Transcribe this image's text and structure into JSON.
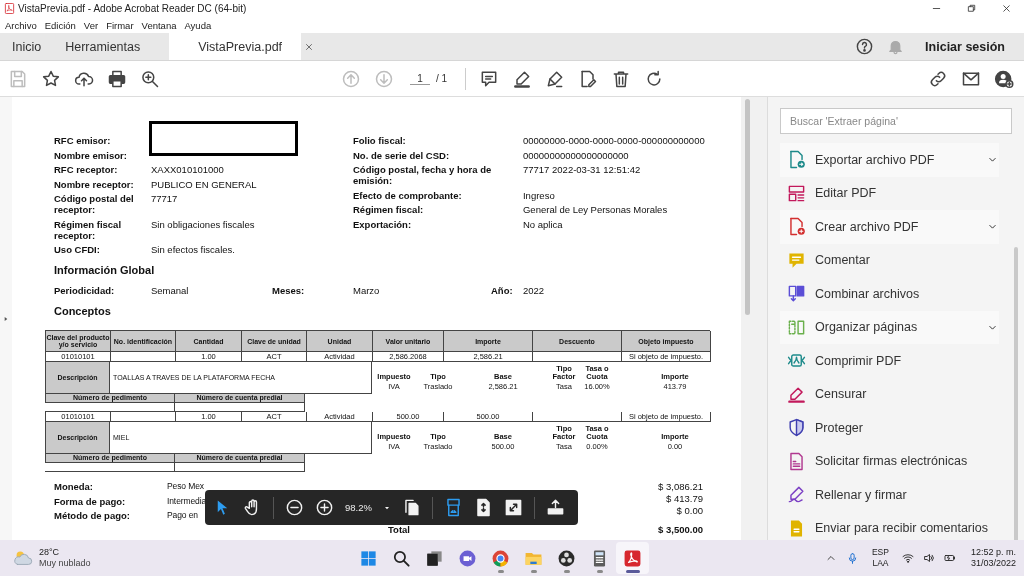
{
  "window": {
    "title": "VistaPrevia.pdf - Adobe Acrobat Reader DC (64-bit)"
  },
  "menu": [
    "Archivo",
    "Edición",
    "Ver",
    "Firmar",
    "Ventana",
    "Ayuda"
  ],
  "tabs": [
    {
      "label": "Inicio",
      "selected": false,
      "kind": "nav"
    },
    {
      "label": "Herramientas",
      "selected": false,
      "kind": "nav"
    },
    {
      "label": "VistaPrevia.pdf",
      "selected": true,
      "kind": "document"
    }
  ],
  "account": {
    "label": "Iniciar sesión"
  },
  "toolbar": {
    "left": [
      {
        "kind": "save",
        "disabled": true
      },
      {
        "kind": "bookmark",
        "disabled": false
      },
      {
        "kind": "upload",
        "disabled": false
      },
      {
        "kind": "print",
        "disabled": false
      },
      {
        "kind": "zoom",
        "disabled": false
      }
    ],
    "nav": [
      {
        "kind": "prev",
        "disabled": true
      },
      {
        "kind": "next",
        "disabled": true
      }
    ],
    "page": "1",
    "page_total": "/ 1",
    "tools": [
      {
        "kind": "comment",
        "disabled": false
      },
      {
        "kind": "highlight",
        "disabled": false
      },
      {
        "kind": "sign",
        "disabled": false
      },
      {
        "kind": "edit",
        "disabled": false
      },
      {
        "kind": "delete",
        "disabled": false
      },
      {
        "kind": "rotate",
        "disabled": false
      }
    ],
    "right": [
      {
        "kind": "link",
        "disabled": false
      },
      {
        "kind": "mail",
        "disabled": false
      },
      {
        "kind": "user",
        "disabled": false
      }
    ]
  },
  "document": {
    "header": {
      "redacted": true,
      "left": [
        {
          "label": "RFC emisor:"
        },
        {
          "label": "Nombre emisor:"
        },
        {
          "label": "RFC receptor:",
          "value": "XAXX010101000"
        },
        {
          "label": "Nombre receptor:",
          "value": "PUBLICO EN GENERAL"
        },
        {
          "label": "Código postal del receptor:",
          "value": "77717"
        },
        {
          "label": "Régimen fiscal receptor:",
          "value": "Sin obligaciones fiscales"
        },
        {
          "label": "Uso CFDI:",
          "value": "Sin efectos fiscales."
        }
      ],
      "right": [
        {
          "label": "Folio fiscal:",
          "value": "00000000-0000-0000-0000-000000000000"
        },
        {
          "label": "No. de serie del CSD:",
          "value": "00000000000000000000"
        },
        {
          "label": "Código postal, fecha y hora de emisión:",
          "value": "77717 2022-03-31 12:51:42"
        },
        {
          "label": "Efecto de comprobante:",
          "value": "Ingreso"
        },
        {
          "label": "Régimen fiscal:",
          "value": "General de Ley Personas Morales"
        },
        {
          "label": "Exportación:",
          "value": "No aplica"
        }
      ]
    },
    "global": {
      "title": "Información Global",
      "fields": [
        {
          "label": "Periodicidad:",
          "value": "Semanal"
        },
        {
          "label": "Meses:",
          "value": "Marzo"
        },
        {
          "label": "Año:",
          "value": "2022"
        }
      ]
    },
    "concepts_title": "Conceptos",
    "table": {
      "columns": [
        "Clave del producto y/o servicio",
        "No. identificación",
        "Cantidad",
        "Clave de unidad",
        "Unidad",
        "Valor unitario",
        "Importe",
        "Descuento",
        "Objeto impuesto"
      ],
      "rows": [
        {
          "clave_producto": "01010101",
          "cantidad": "1.00",
          "clave_unidad": "ACT",
          "unidad": "Actividad",
          "valor_unitario": "2,586.2068",
          "importe": "2,586.21",
          "objeto_impuesto": "Si objeto de impuesto.",
          "description_label": "Descripción",
          "descripcion": "TOALLAS A TRAVES DE LA PLATAFORMA FECHA",
          "tax_columns": [
            "Impuesto",
            "Tipo",
            "Base",
            "Tipo Factor",
            "Tasa o Cuota",
            "Importe"
          ],
          "taxes": [
            {
              "impuesto": "IVA",
              "tipo": "Traslado",
              "base": "2,586.21",
              "tipo_factor": "Tasa",
              "tasa_cuota": "16.00%",
              "importe": "413.79"
            }
          ],
          "pedimento_columns": [
            "Número de pedimento",
            "Número de cuenta predial"
          ]
        },
        {
          "clave_producto": "01010101",
          "cantidad": "1.00",
          "clave_unidad": "ACT",
          "unidad": "Actividad",
          "valor_unitario": "500.00",
          "importe": "500.00",
          "objeto_impuesto": "Si objeto de impuesto.",
          "description_label": "Descripción",
          "descripcion": "MIEL",
          "tax_columns": [
            "Impuesto",
            "Tipo",
            "Base",
            "Tipo Factor",
            "Tasa o Cuota",
            "Importe"
          ],
          "taxes": [
            {
              "impuesto": "IVA",
              "tipo": "Traslado",
              "base": "500.00",
              "tipo_factor": "Tasa",
              "tasa_cuota": "0.00%",
              "importe": "0.00"
            }
          ],
          "pedimento_columns": [
            "Número de pedimento",
            "Número de cuenta predial"
          ]
        }
      ]
    },
    "payment": [
      {
        "label": "Moneda:",
        "value": "Peso Mex"
      },
      {
        "label": "Forma de pago:",
        "value": "Intermedia"
      },
      {
        "label": "Método de pago:",
        "value": "Pago en"
      }
    ],
    "totals": [
      {
        "value": "$ 3,086.21"
      },
      {
        "value": "$ 413.79"
      },
      {
        "value": "$ 0.00"
      },
      {
        "label": "Total",
        "value": "$ 3,500.00"
      }
    ]
  },
  "zoom_bar": {
    "items": [
      {
        "kind": "select",
        "selected": true
      },
      {
        "kind": "hand",
        "selected": false
      },
      {
        "kind": "separator"
      },
      {
        "kind": "zoom_out"
      },
      {
        "kind": "zoom_in"
      },
      {
        "kind": "zoom_value",
        "label": "98.2%"
      },
      {
        "kind": "zoom_menu"
      },
      {
        "kind": "page_display"
      },
      {
        "kind": "separator"
      },
      {
        "kind": "fit_width",
        "selected": true
      },
      {
        "kind": "fit_page",
        "selected": false
      },
      {
        "kind": "full_screen"
      },
      {
        "kind": "separator"
      },
      {
        "kind": "share"
      }
    ]
  },
  "tools_panel": {
    "search": {
      "placeholder": "Buscar 'Extraer página'"
    },
    "items": [
      {
        "label": "Exportar archivo PDF",
        "kind": "export",
        "expandable": true
      },
      {
        "label": "Editar PDF",
        "kind": "edit",
        "expandable": false
      },
      {
        "label": "Crear archivo PDF",
        "kind": "create",
        "expandable": true
      },
      {
        "label": "Comentar",
        "kind": "comment",
        "expandable": false
      },
      {
        "label": "Combinar archivos",
        "kind": "combine",
        "expandable": false
      },
      {
        "label": "Organizar páginas",
        "kind": "organize",
        "expandable": true
      },
      {
        "label": "Comprimir PDF",
        "kind": "compress",
        "expandable": false
      },
      {
        "label": "Censurar",
        "kind": "redact",
        "expandable": false
      },
      {
        "label": "Proteger",
        "kind": "protect",
        "expandable": false
      },
      {
        "label": "Solicitar firmas electrónicas",
        "kind": "request_sign",
        "expandable": false
      },
      {
        "label": "Rellenar y firmar",
        "kind": "fill_sign",
        "expandable": false
      },
      {
        "label": "Enviar para recibir comentarios",
        "kind": "send",
        "expandable": false
      }
    ]
  },
  "taskbar": {
    "weather": {
      "temp": "28°C",
      "text": "Muy nublado"
    },
    "apps": [
      {
        "kind": "start",
        "running": false,
        "selected": false
      },
      {
        "kind": "search",
        "running": false,
        "selected": false
      },
      {
        "kind": "taskview",
        "running": false,
        "selected": false
      },
      {
        "kind": "chat",
        "running": false,
        "selected": false
      },
      {
        "kind": "browser",
        "running": true,
        "selected": false
      },
      {
        "kind": "explorer",
        "running": true,
        "selected": false
      },
      {
        "kind": "recorder",
        "running": true,
        "selected": false
      },
      {
        "kind": "calculator",
        "running": true,
        "selected": false
      },
      {
        "kind": "acrobat",
        "running": true,
        "selected": true
      }
    ],
    "tray": {
      "lang": "ESP",
      "layout": "LAA",
      "time": "12:52 p. m.",
      "date": "31/03/2022"
    }
  }
}
